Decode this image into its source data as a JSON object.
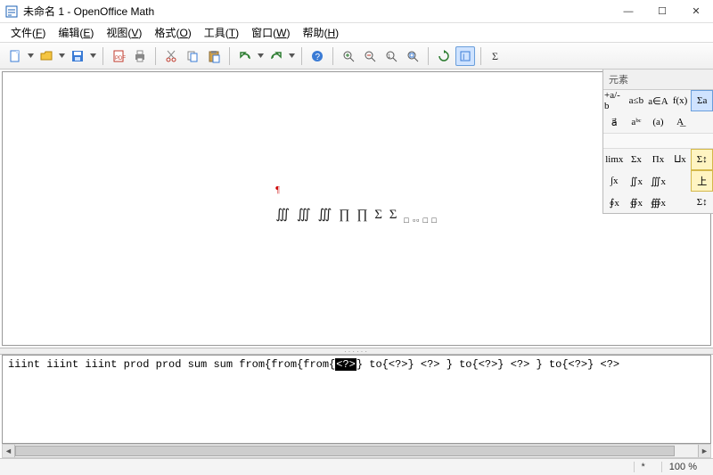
{
  "window": {
    "title": "未命名 1 - OpenOffice Math",
    "controls": {
      "min": "—",
      "max": "☐",
      "close": "✕"
    }
  },
  "menu": {
    "file": {
      "label": "文件",
      "accel": "F"
    },
    "edit": {
      "label": "编辑",
      "accel": "E"
    },
    "view": {
      "label": "视图",
      "accel": "V"
    },
    "format": {
      "label": "格式",
      "accel": "O"
    },
    "tools": {
      "label": "工具",
      "accel": "T"
    },
    "window": {
      "label": "窗口",
      "accel": "W"
    },
    "help": {
      "label": "帮助",
      "accel": "H"
    }
  },
  "toolbar_icons": {
    "new": "new-icon",
    "open": "open-icon",
    "save": "save-icon",
    "mail": "mail-icon",
    "print": "print-icon",
    "cut": "cut-icon",
    "copy": "copy-icon",
    "paste": "paste-icon",
    "undo": "undo-icon",
    "redo": "redo-icon",
    "help": "help-icon",
    "zoomin": "zoom-in-icon",
    "zoomout": "zoom-out-icon",
    "zoom100": "zoom-100-icon",
    "zoomfit": "zoom-fit-icon",
    "refresh": "refresh-icon",
    "formula_cursor": "formula-cursor-icon",
    "sigma": "sigma-icon"
  },
  "elements": {
    "title": "元素",
    "cats": [
      "+a/-b",
      "a≤b",
      "a∈A",
      "f(x)",
      "Σa",
      "a⃗",
      "aᵇᶜ",
      "(a)",
      "A͟"
    ],
    "ops": [
      "limx",
      "Σx",
      "Πx",
      "⨿x",
      "Σ↕",
      "∫x",
      "∬x",
      "∭x",
      "",
      "上",
      "∮x",
      "∯x",
      "∰x",
      "",
      "Σ↕"
    ]
  },
  "formula": {
    "rendered_symbols": "∭  ∭  ∭  ∏  ∏  Σ  Σ",
    "cursor_mark": "¶",
    "placeholders": "□ ▫▫ □ □"
  },
  "code": {
    "pre": "iiint iiint iiint prod prod sum sum from{from{from{",
    "selection": "<?>",
    "post1": "} to{<?>} <?> } to{<?>} <?> } to{<?>} <?>"
  },
  "status": {
    "modified": "*",
    "zoom": "100 %"
  }
}
